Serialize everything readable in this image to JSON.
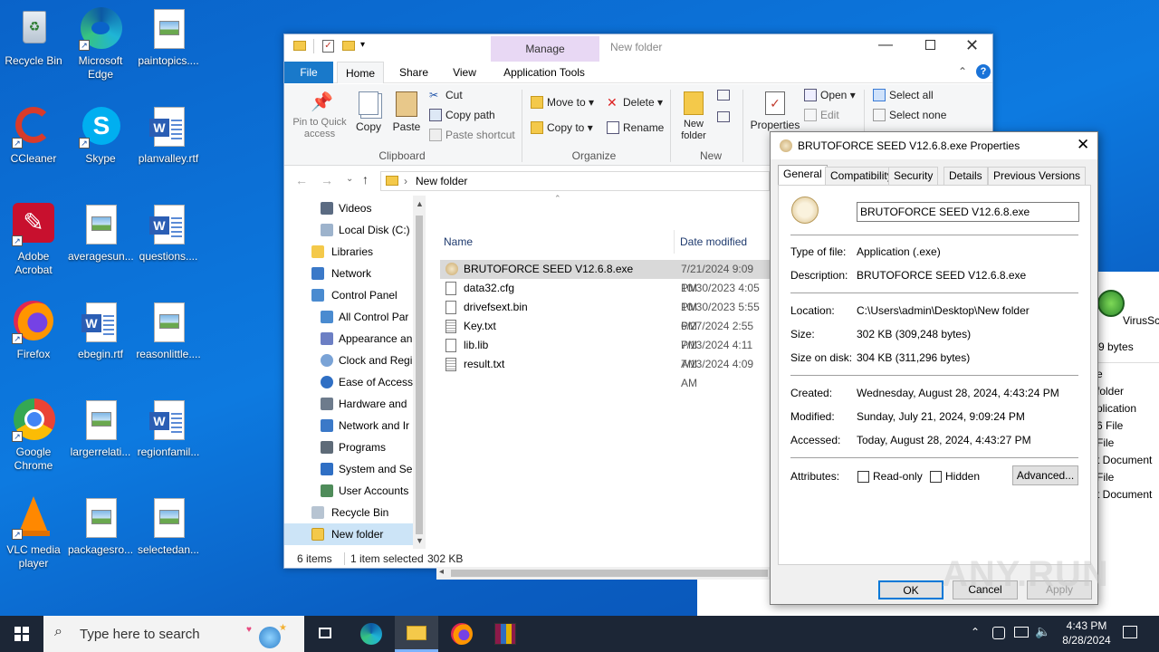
{
  "desktop": {
    "icons": [
      {
        "label": "Recycle Bin"
      },
      {
        "label": "Microsoft Edge"
      },
      {
        "label": "paintopics...."
      },
      {
        "label": "CCleaner"
      },
      {
        "label": "Skype"
      },
      {
        "label": "planvalley.rtf"
      },
      {
        "label": "Adobe Acrobat"
      },
      {
        "label": "averagesun..."
      },
      {
        "label": "questions...."
      },
      {
        "label": "Firefox"
      },
      {
        "label": "ebegin.rtf"
      },
      {
        "label": "reasonlittle...."
      },
      {
        "label": "Google Chrome"
      },
      {
        "label": "largerrelati..."
      },
      {
        "label": "regionfamil..."
      },
      {
        "label": "VLC media player"
      },
      {
        "label": "packagesro..."
      },
      {
        "label": "selectedan..."
      }
    ]
  },
  "explorer": {
    "title": "New folder",
    "manage_tab": "Manage",
    "tabs": [
      "File",
      "Home",
      "Share",
      "View",
      "Application Tools"
    ],
    "ribbon": {
      "pin_quick_access": "Pin to Quick access",
      "copy": "Copy",
      "paste": "Paste",
      "cut": "Cut",
      "copy_path": "Copy path",
      "paste_shortcut": "Paste shortcut",
      "clipboard_group": "Clipboard",
      "move_to": "Move to",
      "copy_to": "Copy to",
      "delete": "Delete",
      "rename": "Rename",
      "organize_group": "Organize",
      "new_folder": "New folder",
      "new_group": "New",
      "properties": "Properties",
      "open": "Open",
      "edit": "Edit",
      "select_all": "Select all",
      "select_none": "Select none"
    },
    "address": {
      "crumb": "New folder"
    },
    "nav_items": [
      {
        "label": "Videos"
      },
      {
        "label": "Local Disk (C:)"
      },
      {
        "label": "Libraries"
      },
      {
        "label": "Network"
      },
      {
        "label": "Control Panel"
      },
      {
        "label": "All Control Par"
      },
      {
        "label": "Appearance an"
      },
      {
        "label": "Clock and Regi"
      },
      {
        "label": "Ease of Access"
      },
      {
        "label": "Hardware and"
      },
      {
        "label": "Network and Ir"
      },
      {
        "label": "Programs"
      },
      {
        "label": "System and Se"
      },
      {
        "label": "User Accounts"
      },
      {
        "label": "Recycle Bin"
      },
      {
        "label": "New folder"
      }
    ],
    "columns": {
      "name": "Name",
      "date": "Date modified"
    },
    "files": [
      {
        "name": "BRUTOFORCE SEED V12.6.8.exe",
        "date": "7/21/2024 9:09 PM",
        "selected": true
      },
      {
        "name": "data32.cfg",
        "date": "10/30/2023 4:05 PM",
        "selected": false
      },
      {
        "name": "drivefsext.bin",
        "date": "10/30/2023 5:55 PM",
        "selected": false
      },
      {
        "name": "Key.txt",
        "date": "6/27/2024 2:55 PM",
        "selected": false
      },
      {
        "name": "lib.lib",
        "date": "7/13/2024 4:11 AM",
        "selected": false
      },
      {
        "name": "result.txt",
        "date": "7/13/2024 4:09 AM",
        "selected": false
      }
    ],
    "status": {
      "count": "6 items",
      "selected": "1 item selected",
      "size": "302 KB"
    }
  },
  "properties": {
    "title": "BRUTOFORCE SEED V12.6.8.exe Properties",
    "tabs": [
      "General",
      "Compatibility",
      "Security",
      "Details",
      "Previous Versions"
    ],
    "filename": "BRUTOFORCE SEED V12.6.8.exe",
    "type_label": "Type of file:",
    "type_value": "Application (.exe)",
    "desc_label": "Description:",
    "desc_value": "BRUTOFORCE SEED V12.6.8.exe",
    "location_label": "Location:",
    "location_value": "C:\\Users\\admin\\Desktop\\New folder",
    "size_label": "Size:",
    "size_value": "302 KB (309,248 bytes)",
    "sizedisk_label": "Size on disk:",
    "sizedisk_value": "304 KB (311,296 bytes)",
    "created_label": "Created:",
    "created_value": "Wednesday, August 28, 2024, 4:43:24 PM",
    "modified_label": "Modified:",
    "modified_value": "Sunday, July 21, 2024, 9:09:24 PM",
    "accessed_label": "Accessed:",
    "accessed_value": "Today, August 28, 2024, 4:43:27 PM",
    "attributes_label": "Attributes:",
    "readonly": "Read-only",
    "hidden": "Hidden",
    "advanced": "Advanced...",
    "ok": "OK",
    "cancel": "Cancel",
    "apply": "Apply"
  },
  "background_window": {
    "icon_label": "VirusSc",
    "bytes": "9 bytes",
    "list": [
      "e",
      "folder",
      "plication",
      "6 File",
      "File",
      "t Document",
      "File",
      "t Document"
    ]
  },
  "taskbar": {
    "search_placeholder": "Type here to search",
    "time": "4:43 PM",
    "date": "8/28/2024"
  },
  "watermark": "ANY.RUN"
}
